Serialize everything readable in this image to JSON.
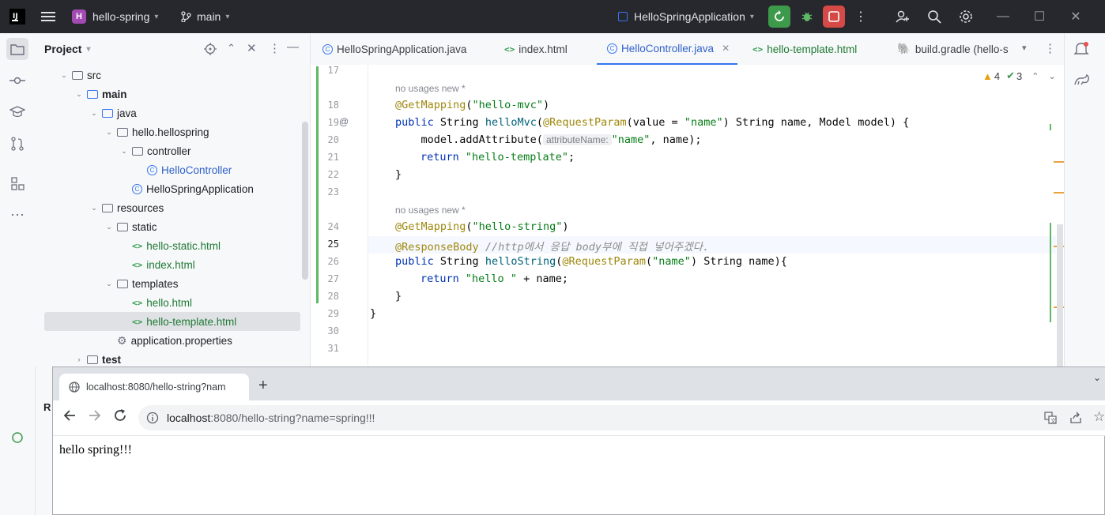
{
  "titlebar": {
    "project_badge": "H",
    "project_name": "hello-spring",
    "branch": "main",
    "run_config": "HelloSpringApplication"
  },
  "project_panel": {
    "title": "Project",
    "tree": [
      {
        "label": "src",
        "depth": 0,
        "kind": "folder"
      },
      {
        "label": "main",
        "depth": 1,
        "kind": "folder-blue"
      },
      {
        "label": "java",
        "depth": 2,
        "kind": "folder-blue"
      },
      {
        "label": "hello.hellospring",
        "depth": 3,
        "kind": "package"
      },
      {
        "label": "controller",
        "depth": 4,
        "kind": "package"
      },
      {
        "label": "HelloController",
        "depth": 5,
        "kind": "class"
      },
      {
        "label": "HelloSpringApplication",
        "depth": 4,
        "kind": "class"
      },
      {
        "label": "resources",
        "depth": 2,
        "kind": "folder"
      },
      {
        "label": "static",
        "depth": 3,
        "kind": "folder"
      },
      {
        "label": "hello-static.html",
        "depth": 4,
        "kind": "html"
      },
      {
        "label": "index.html",
        "depth": 4,
        "kind": "html"
      },
      {
        "label": "templates",
        "depth": 3,
        "kind": "folder"
      },
      {
        "label": "hello.html",
        "depth": 4,
        "kind": "html"
      },
      {
        "label": "hello-template.html",
        "depth": 4,
        "kind": "html"
      },
      {
        "label": "application.properties",
        "depth": 3,
        "kind": "props"
      },
      {
        "label": "test",
        "depth": 1,
        "kind": "folder"
      }
    ]
  },
  "tabs": [
    {
      "label": "HelloSpringApplication.java",
      "icon": "class-icon"
    },
    {
      "label": "index.html",
      "icon": "html-icon"
    },
    {
      "label": "HelloController.java",
      "icon": "class-icon",
      "active": true
    },
    {
      "label": "hello-template.html",
      "icon": "html-icon"
    },
    {
      "label": "build.gradle (hello-s",
      "icon": "gradle-icon"
    }
  ],
  "inspections": {
    "warnings": "4",
    "checks": "3"
  },
  "editor": {
    "line_numbers": [
      "17",
      "18",
      "19",
      "20",
      "21",
      "22",
      "23",
      "24",
      "25",
      "26",
      "27",
      "28",
      "29",
      "30",
      "31"
    ],
    "hint1": "no usages   new *",
    "hint2": "no usages   new *",
    "lines": {
      "l18": [
        "@GetMapping",
        "(",
        "\"hello-mvc\"",
        ")"
      ],
      "l19_kw": "public",
      "l19_type": " String ",
      "l19_method": "helloMvc",
      "l19_open": "(",
      "l19_ann": "@RequestParam",
      "l19_rest1": "(value = ",
      "l19_str": "\"name\"",
      "l19_rest2": ") String name, Model model) {",
      "l20_a": "    model.addAttribute(",
      "l20_inlay": "attributeName:",
      "l20_str": "\"name\"",
      "l20_b": ", name);",
      "l21_kw": "return",
      "l21_str": "\"hello-template\"",
      "l21_end": ";",
      "l22": "}",
      "l24_ann": "@GetMapping",
      "l24_str": "\"hello-string\"",
      "l25_ann": "@ResponseBody",
      "l25_cmt": "//http에서 응답 body부에 직접 넣어주겠다.",
      "l26_kw": "public",
      "l26_type": " String ",
      "l26_method": "helloString",
      "l26_ann": "@RequestParam",
      "l26_str": "\"name\"",
      "l26_rest": ") String name){",
      "l27_kw": "return",
      "l27_str": "\"hello \"",
      "l27_rest": " + name;",
      "l28": "}",
      "l29": "}"
    }
  },
  "browser": {
    "tab_title": "localhost:8080/hello-string?nam",
    "new_tab": "+",
    "url_host": "localhost",
    "url_rest": ":8080/hello-string?name=spring!!!",
    "page_text": "hello spring!!!"
  },
  "colors": {
    "titlebar_bg": "#27282e",
    "accent": "#3574f0",
    "run_green": "#3c9a4a",
    "stop_red": "#d54a46"
  }
}
